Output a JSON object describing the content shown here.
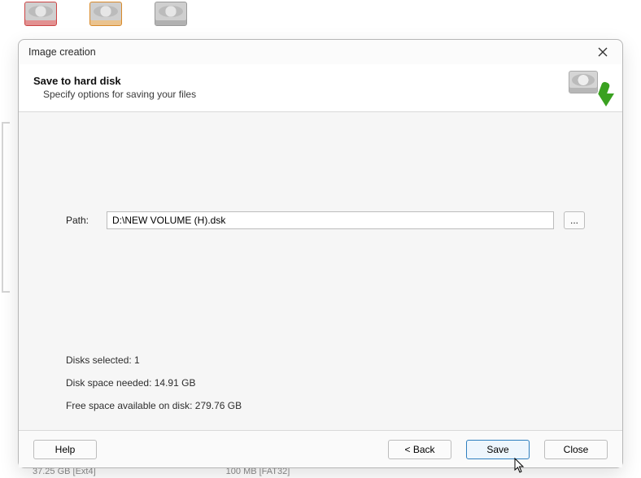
{
  "bg": {
    "bottom_left": "37.25 GB [Ext4]",
    "bottom_right": "100 MB [FAT32]"
  },
  "dialog": {
    "title": "Image creation",
    "header": {
      "heading": "Save to hard disk",
      "sub": "Specify options for saving your files"
    },
    "path": {
      "label": "Path:",
      "value": "D:\\NEW VOLUME (H).dsk",
      "browse": "..."
    },
    "info": {
      "disks_selected_label": "Disks selected:",
      "disks_selected_value": "1",
      "space_needed_label": "Disk space needed:",
      "space_needed_value": "14.91 GB",
      "free_space_label": "Free space available on disk:",
      "free_space_value": "279.76 GB"
    },
    "buttons": {
      "help": "Help",
      "back": "< Back",
      "save": "Save",
      "close": "Close"
    }
  }
}
